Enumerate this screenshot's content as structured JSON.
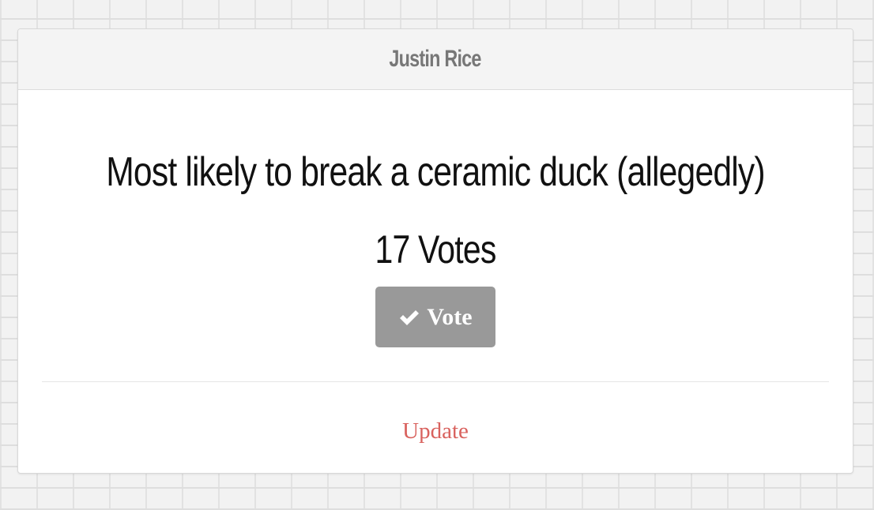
{
  "card": {
    "header_title": "Justin Rice",
    "award_title": "Most likely to break a ceramic duck (allegedly)",
    "vote_count": "17 Votes",
    "vote_button_label": "Vote",
    "vote_button_icon": "checkmark-icon",
    "update_link": "Update"
  },
  "colors": {
    "vote_button_bg": "#999999",
    "update_link": "#d9625e",
    "header_bg": "#f4f4f4",
    "header_text": "#777777"
  }
}
